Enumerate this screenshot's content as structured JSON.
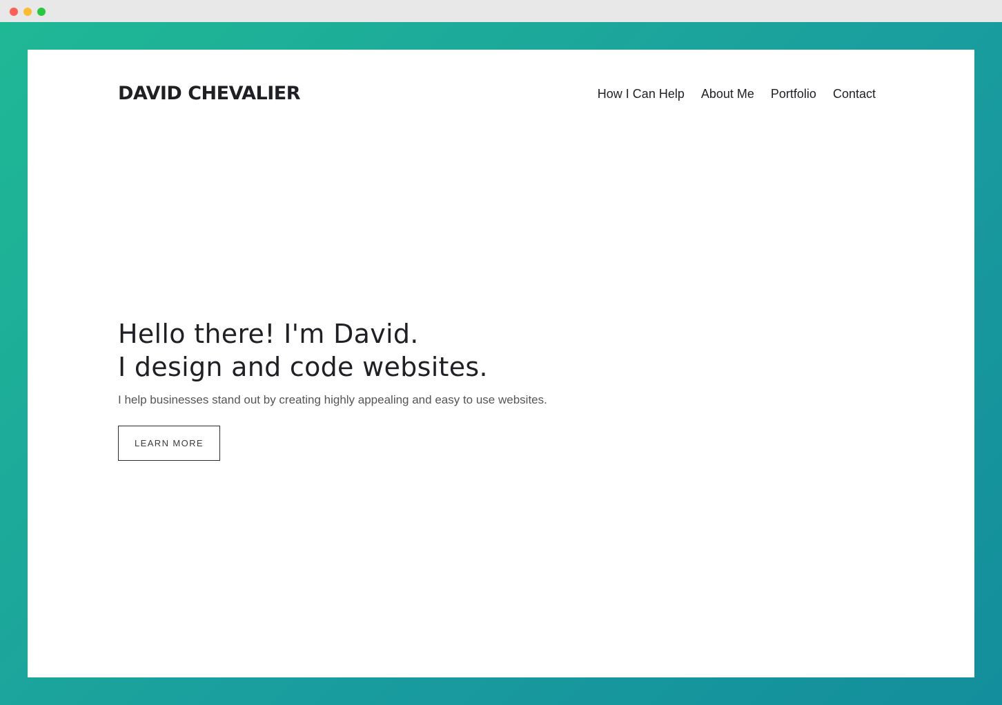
{
  "colors": {
    "gradient_start": "#1fb895",
    "gradient_end": "#138e9c",
    "card_background": "#ffffff",
    "text_primary": "#1f1f24",
    "text_secondary": "#555558"
  },
  "window": {
    "controls": [
      "close-icon",
      "minimize-icon",
      "zoom-icon"
    ]
  },
  "site": {
    "brand": "DAVID CHEVALIER",
    "nav": {
      "items": [
        {
          "label": "How I Can Help"
        },
        {
          "label": "About Me"
        },
        {
          "label": "Portfolio"
        },
        {
          "label": "Contact"
        }
      ]
    }
  },
  "hero": {
    "heading_line_1": "Hello there! I'm David.",
    "heading_line_2": "I design and code websites.",
    "subheading": "I help businesses stand out by creating highly appealing and easy to use websites.",
    "button_label": "LEARN MORE"
  }
}
